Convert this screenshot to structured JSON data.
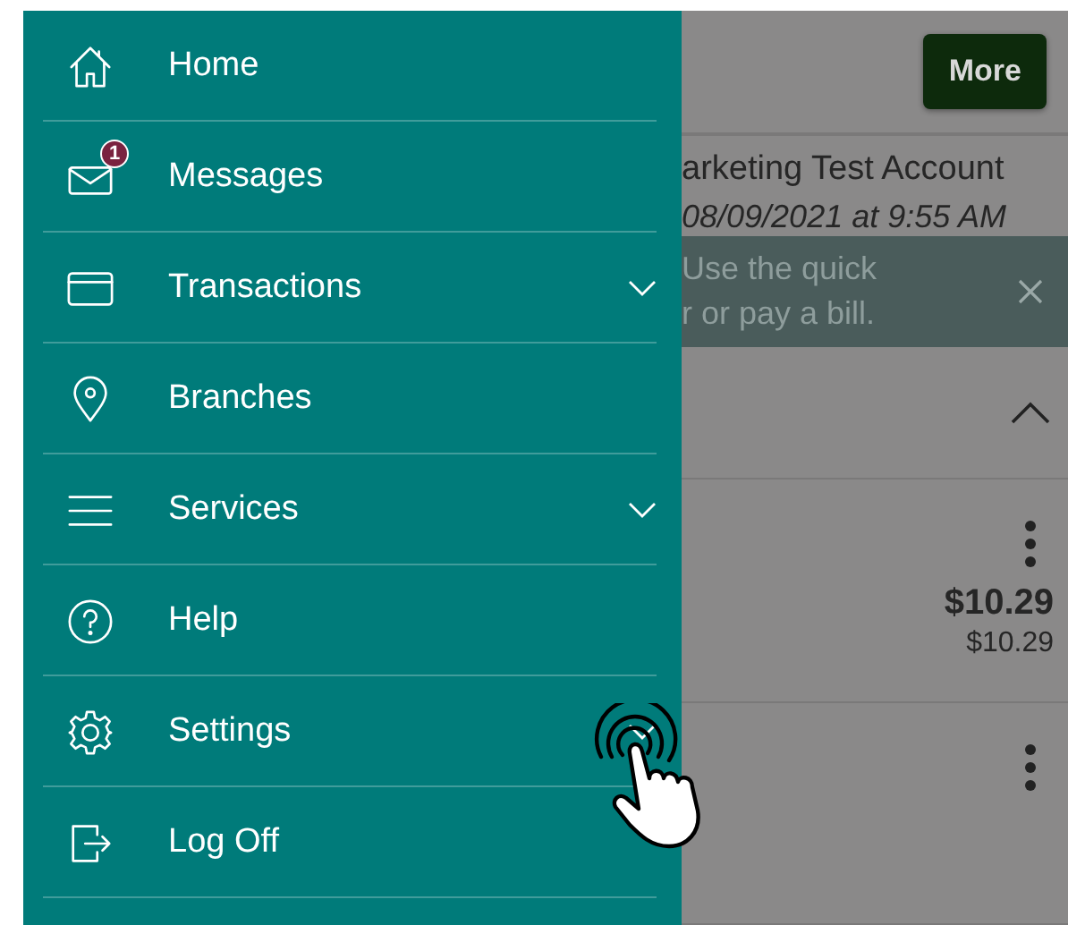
{
  "menu": [
    {
      "label": "Home",
      "expandable": false
    },
    {
      "label": "Messages",
      "expandable": false,
      "badge": "1"
    },
    {
      "label": "Transactions",
      "expandable": true
    },
    {
      "label": "Branches",
      "expandable": false
    },
    {
      "label": "Services",
      "expandable": true
    },
    {
      "label": "Help",
      "expandable": false
    },
    {
      "label": "Settings",
      "expandable": true
    },
    {
      "label": "Log Off",
      "expandable": false
    }
  ],
  "background": {
    "more_button": "More",
    "account_name": "arketing Test Account",
    "account_date": "08/09/2021 at 9:55 AM",
    "banner_lines": [
      "Use the quick",
      "r or pay a bill."
    ],
    "rows": [
      {
        "amount": "$10.29",
        "available": "$10.29"
      },
      {}
    ]
  }
}
